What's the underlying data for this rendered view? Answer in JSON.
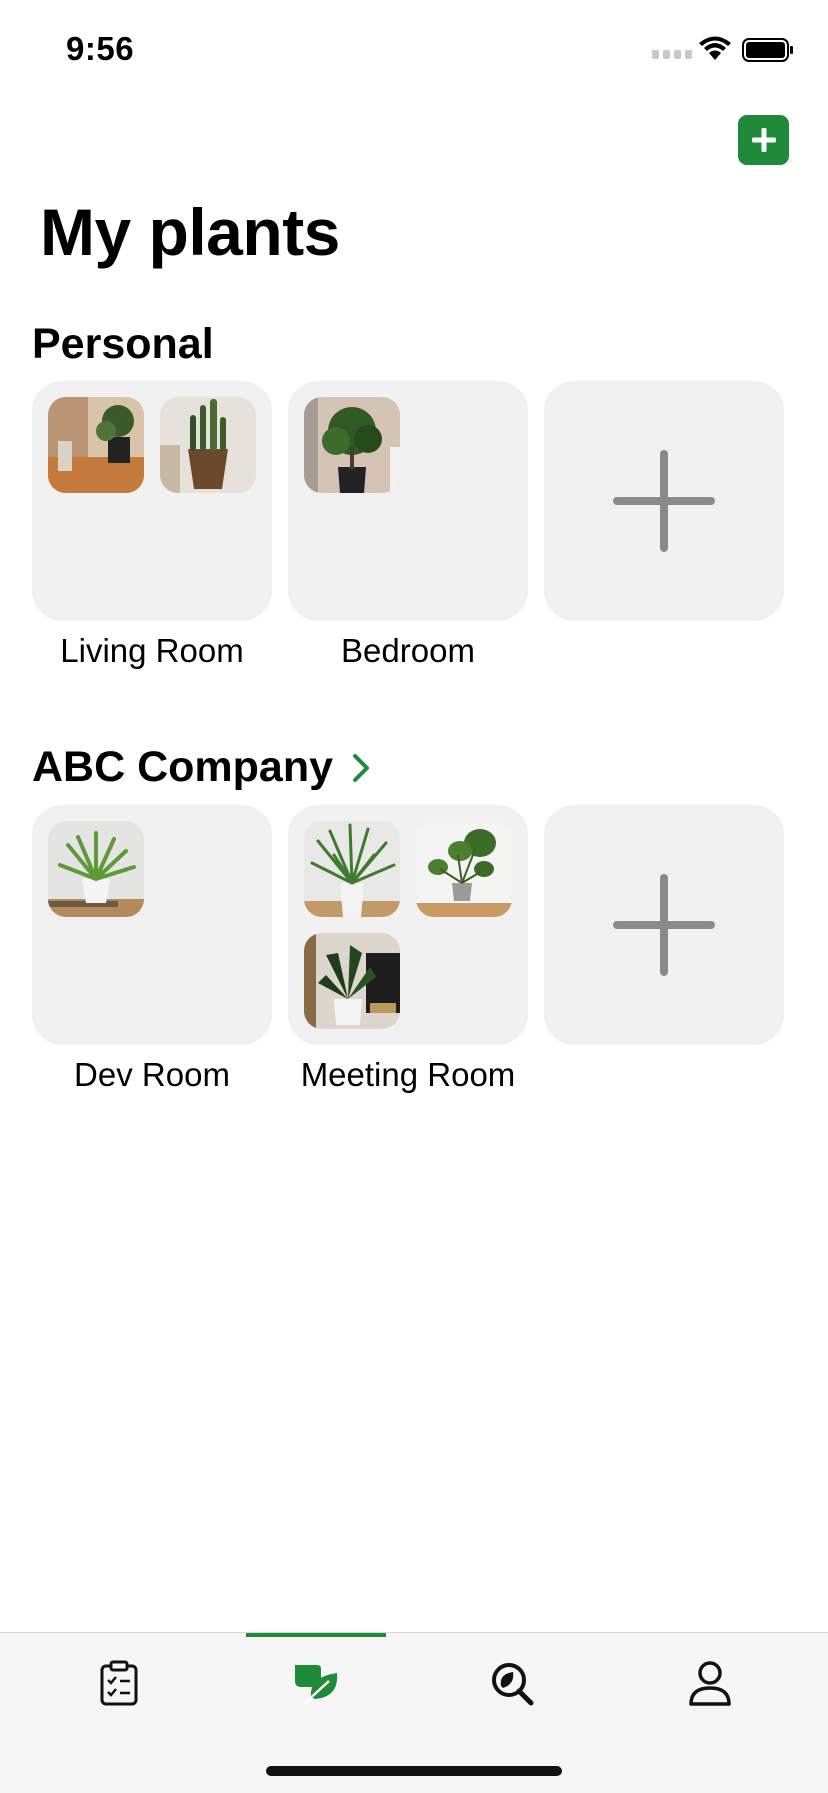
{
  "status_bar": {
    "time": "9:56"
  },
  "header": {
    "title": "My plants",
    "add_icon": "plus-icon",
    "accent_color": "#1f8a3a"
  },
  "groups": [
    {
      "name": "Personal",
      "rooms": [
        {
          "name": "Living Room",
          "photos": 2
        },
        {
          "name": "Bedroom",
          "photos": 1
        }
      ]
    },
    {
      "name": "ABC Company",
      "has_chevron": true,
      "rooms": [
        {
          "name": "Dev Room",
          "photos": 1
        },
        {
          "name": "Meeting Room",
          "photos": 3
        }
      ]
    }
  ],
  "tab_bar": {
    "tabs": [
      {
        "icon": "clipboard-checklist-icon",
        "selected": false
      },
      {
        "icon": "leaf-icon",
        "selected": true
      },
      {
        "icon": "search-leaf-icon",
        "selected": false
      },
      {
        "icon": "profile-icon",
        "selected": false
      }
    ]
  }
}
